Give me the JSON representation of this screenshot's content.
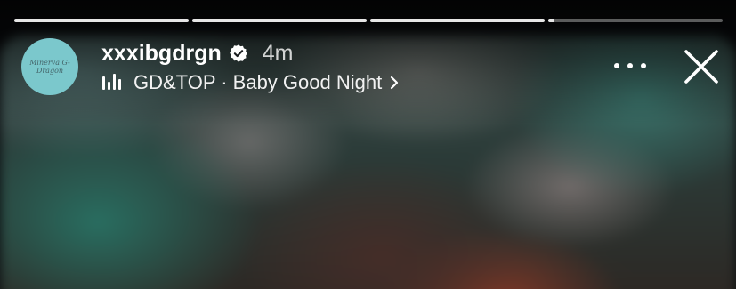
{
  "story": {
    "progress": [
      1,
      1,
      1,
      0.03
    ],
    "user": {
      "username": "xxxibgdrgn",
      "verified": true,
      "time_ago": "4m",
      "avatar_text": "Minerva G-Dragon"
    },
    "music": {
      "artist": "GD&TOP",
      "song": "Baby Good Night",
      "display": "GD&TOP · Baby Good Night"
    },
    "icons": {
      "verified": "verified-badge-icon",
      "music": "music-bars-icon",
      "chevron": "chevron-right-icon",
      "more": "more-dots-icon",
      "close": "close-icon"
    },
    "colors": {
      "avatar_bg": "#7bc8cc",
      "progress_fill": "#e6e6e6"
    }
  }
}
